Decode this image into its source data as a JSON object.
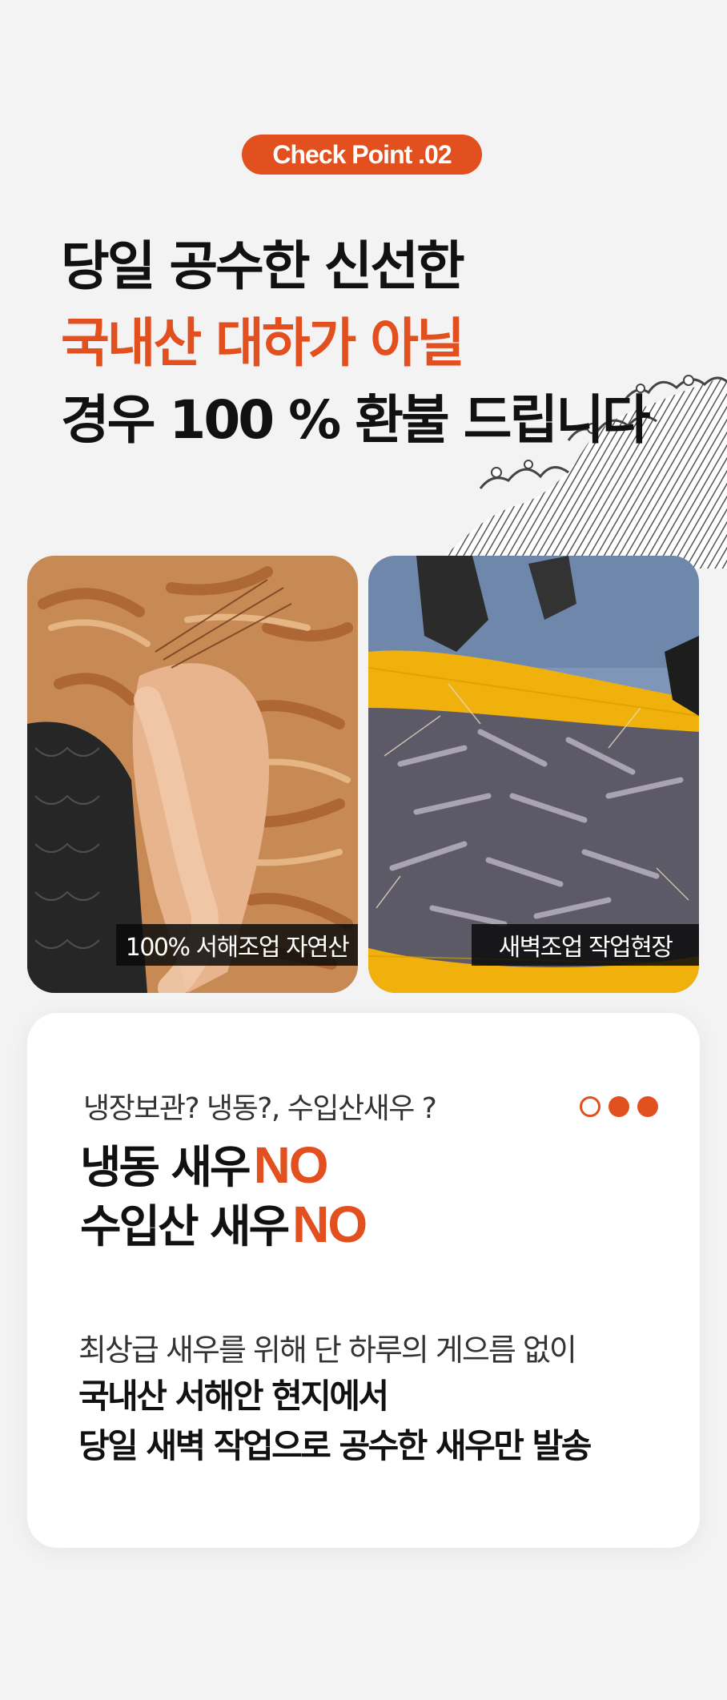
{
  "badge": "Check Point .02",
  "headline": {
    "line1": "당일 공수한 신선한",
    "line2": "국내산 대하가 아닐",
    "line3": "경우 100 % 환불 드립니다"
  },
  "photos": [
    {
      "caption": "100% 서해조업 자연산"
    },
    {
      "caption": "새벽조업 작업현장"
    }
  ],
  "card": {
    "question": "냉장보관? 냉동?, 수입산새우 ?",
    "line1_text": "냉동 새우",
    "line1_no": "NO",
    "line2_text": "수입산 새우",
    "line2_no": "NO",
    "subtitle": "최상급 새우를 위해  단 하루의 게으름 없이",
    "desc_line1": "국내산 서해안 현지에서",
    "desc_line2": "당일 새벽 작업으로 공수한 새우만 발송"
  },
  "colors": {
    "accent": "#e2501f",
    "text": "#111111",
    "background": "#f3f3f3",
    "card": "#ffffff"
  }
}
